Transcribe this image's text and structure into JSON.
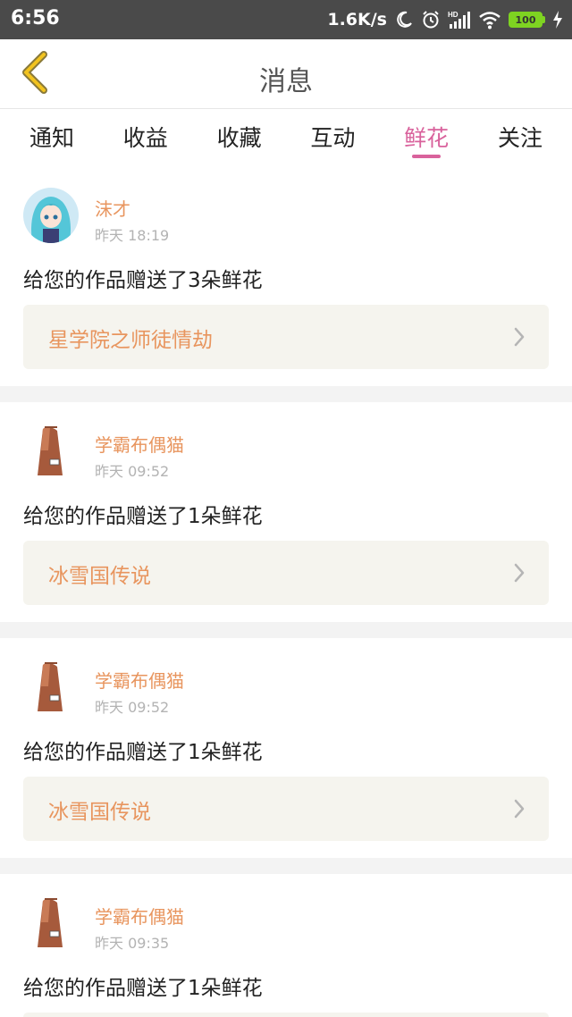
{
  "status_bar": {
    "time": "6:56",
    "speed": "1.6K/s",
    "battery": "100",
    "icons": [
      "moon-icon",
      "alarm-icon",
      "hd-signal-icon",
      "wifi-icon",
      "battery-icon",
      "charging-icon"
    ]
  },
  "header": {
    "title": "消息",
    "back_icon": "chevron-left-icon",
    "accent_color": "#d9a520"
  },
  "tabs": [
    {
      "label": "通知",
      "active": false
    },
    {
      "label": "收益",
      "active": false
    },
    {
      "label": "收藏",
      "active": false
    },
    {
      "label": "互动",
      "active": false
    },
    {
      "label": "鲜花",
      "active": true
    },
    {
      "label": "关注",
      "active": false
    }
  ],
  "colors": {
    "active_tab": "#d9629c",
    "username": "#e8955e",
    "card_bg": "#f5f4ee"
  },
  "messages": [
    {
      "user": "沫才",
      "time": "昨天 18:19",
      "text": "给您的作品赠送了3朵鲜花",
      "work": "星学院之师徒情劫",
      "avatar": "anime-girl-avatar"
    },
    {
      "user": "学霸布偶猫",
      "time": "昨天 09:52",
      "text": "给您的作品赠送了1朵鲜花",
      "work": "冰雪国传说",
      "avatar": "coat-avatar"
    },
    {
      "user": "学霸布偶猫",
      "time": "昨天 09:52",
      "text": "给您的作品赠送了1朵鲜花",
      "work": "冰雪国传说",
      "avatar": "coat-avatar"
    },
    {
      "user": "学霸布偶猫",
      "time": "昨天 09:35",
      "text": "给您的作品赠送了1朵鲜花",
      "work": "",
      "avatar": "coat-avatar"
    }
  ]
}
